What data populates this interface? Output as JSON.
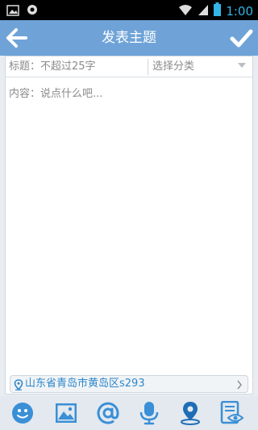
{
  "status_bar": {
    "time": "1:00",
    "icons": [
      "picture-icon",
      "sync-icon",
      "wifi-icon",
      "signal-icon",
      "battery-icon"
    ]
  },
  "header": {
    "title": "发表主题",
    "back_icon": "arrow-left-icon",
    "done_icon": "check-icon"
  },
  "form": {
    "title_placeholder": "标题：不超过25字",
    "category_placeholder": "选择分类",
    "content_placeholder": "内容：说点什么吧..."
  },
  "location": {
    "text": "山东省青岛市黄岛区s293"
  },
  "toolbar": {
    "items": [
      "emoji-icon",
      "image-icon",
      "at-icon",
      "microphone-icon",
      "location-icon",
      "preview-icon"
    ]
  },
  "colors": {
    "header": "#6fa3d8",
    "accent": "#2f87c9",
    "toolbar": "#e3e9ef"
  }
}
